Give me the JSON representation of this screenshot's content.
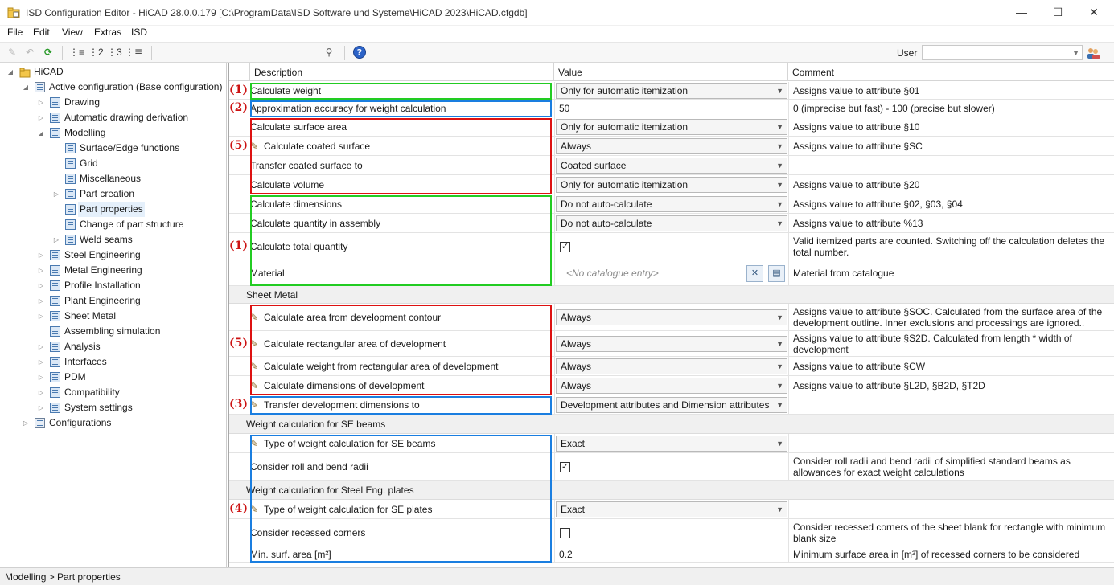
{
  "window": {
    "title": "ISD Configuration Editor  -  HiCAD 28.0.0.179 [C:\\ProgramData\\ISD Software und Systeme\\HiCAD 2023\\HiCAD.cfgdb]",
    "minimize": "—",
    "maximize": "☐",
    "close": "✕"
  },
  "menu": [
    "File",
    "Edit",
    "View",
    "Extras",
    "ISD"
  ],
  "toolbar": {
    "user_label": "User",
    "user_value": ""
  },
  "tree": [
    {
      "label": "HiCAD",
      "level": 0,
      "exp": "◢",
      "icon": "folder"
    },
    {
      "label": "Active configuration (Base configuration)",
      "level": 1,
      "exp": "◢",
      "icon": "config"
    },
    {
      "label": "Drawing",
      "level": 2,
      "exp": "▷"
    },
    {
      "label": "Automatic drawing derivation",
      "level": 2,
      "exp": "▷"
    },
    {
      "label": "Modelling",
      "level": 2,
      "exp": "◢"
    },
    {
      "label": "Surface/Edge functions",
      "level": 3,
      "exp": ""
    },
    {
      "label": "Grid",
      "level": 3,
      "exp": ""
    },
    {
      "label": "Miscellaneous",
      "level": 3,
      "exp": ""
    },
    {
      "label": "Part creation",
      "level": 3,
      "exp": "▷"
    },
    {
      "label": "Part properties",
      "level": 3,
      "exp": "",
      "selected": true
    },
    {
      "label": "Change of part structure",
      "level": 3,
      "exp": ""
    },
    {
      "label": "Weld seams",
      "level": 3,
      "exp": "▷"
    },
    {
      "label": "Steel Engineering",
      "level": 2,
      "exp": "▷"
    },
    {
      "label": "Metal Engineering",
      "level": 2,
      "exp": "▷"
    },
    {
      "label": "Profile Installation",
      "level": 2,
      "exp": "▷"
    },
    {
      "label": "Plant Engineering",
      "level": 2,
      "exp": "▷"
    },
    {
      "label": "Sheet Metal",
      "level": 2,
      "exp": "▷"
    },
    {
      "label": "Assembling simulation",
      "level": 2,
      "exp": ""
    },
    {
      "label": "Analysis",
      "level": 2,
      "exp": "▷"
    },
    {
      "label": "Interfaces",
      "level": 2,
      "exp": "▷"
    },
    {
      "label": "PDM",
      "level": 2,
      "exp": "▷"
    },
    {
      "label": "Compatibility",
      "level": 2,
      "exp": "▷"
    },
    {
      "label": "System settings",
      "level": 2,
      "exp": "▷"
    },
    {
      "label": "Configurations",
      "level": 1,
      "exp": "▷",
      "icon": "config"
    }
  ],
  "grid": {
    "headers": {
      "desc": "Description",
      "value": "Value",
      "comment": "Comment"
    },
    "rows": [
      {
        "type": "row",
        "desc": "Calculate weight",
        "vtype": "combo",
        "value": "Only for automatic itemization",
        "comment": "Assigns value to attribute §01"
      },
      {
        "type": "row",
        "desc": "Approximation accuracy for weight calculation",
        "vtype": "text",
        "value": "50",
        "comment": "0 (imprecise but fast) - 100 (precise but slower)"
      },
      {
        "type": "row",
        "desc": "Calculate surface area",
        "vtype": "combo",
        "value": "Only for automatic itemization",
        "comment": "Assigns value to attribute §10"
      },
      {
        "type": "row",
        "desc": "Calculate coated surface",
        "pencil": true,
        "vtype": "combo",
        "value": "Always",
        "comment": "Assigns value to attribute §SC"
      },
      {
        "type": "row",
        "desc": "Transfer coated surface to",
        "vtype": "combo",
        "value": "Coated surface",
        "comment": ""
      },
      {
        "type": "row",
        "desc": "Calculate volume",
        "vtype": "combo",
        "value": "Only for automatic itemization",
        "comment": "Assigns value to attribute §20"
      },
      {
        "type": "row",
        "desc": "Calculate dimensions",
        "vtype": "combo",
        "value": "Do not auto-calculate",
        "comment": "Assigns value to attribute §02, §03, §04"
      },
      {
        "type": "row",
        "desc": "Calculate quantity in assembly",
        "vtype": "combo",
        "value": "Do not auto-calculate",
        "comment": "Assigns value to attribute %13"
      },
      {
        "type": "row",
        "desc": "Calculate total quantity",
        "vtype": "check",
        "checked": true,
        "comment": "Valid itemized parts are counted. Switching off the calculation deletes the total number."
      },
      {
        "type": "row",
        "desc": "Material",
        "vtype": "catalogue",
        "value": "<No catalogue entry>",
        "comment": "Material from catalogue"
      },
      {
        "type": "section",
        "title": "Sheet Metal"
      },
      {
        "type": "row",
        "desc": "Calculate area from development contour",
        "pencil": true,
        "vtype": "combo",
        "value": "Always",
        "comment": "Assigns value to attribute §SOC. Calculated from the surface area of the development outline. Inner exclusions and processings are ignored.."
      },
      {
        "type": "row",
        "desc": "Calculate rectangular area of development",
        "pencil": true,
        "vtype": "combo",
        "value": "Always",
        "comment": "Assigns value to attribute §S2D. Calculated from length * width of development"
      },
      {
        "type": "row",
        "desc": "Calculate weight from rectangular area of development",
        "pencil": true,
        "vtype": "combo",
        "value": "Always",
        "comment": "Assigns value to attribute §CW"
      },
      {
        "type": "row",
        "desc": "Calculate dimensions of development",
        "pencil": true,
        "vtype": "combo",
        "value": "Always",
        "comment": "Assigns value to attribute §L2D, §B2D, §T2D"
      },
      {
        "type": "row",
        "desc": "Transfer development dimensions to",
        "pencil": true,
        "vtype": "combo",
        "value": "Development attributes and Dimension attributes",
        "comment": ""
      },
      {
        "type": "section",
        "title": "Weight calculation for SE beams"
      },
      {
        "type": "row",
        "desc": "Type of weight calculation for SE beams",
        "pencil": true,
        "vtype": "combo",
        "value": "Exact",
        "comment": ""
      },
      {
        "type": "row",
        "desc": "Consider roll and bend radii",
        "vtype": "check",
        "checked": true,
        "comment": "Consider roll radii and bend radii of simplified standard beams as allowances for exact weight calculations"
      },
      {
        "type": "section",
        "title": "Weight calculation for Steel Eng. plates"
      },
      {
        "type": "row",
        "desc": "Type of weight calculation for SE plates",
        "pencil": true,
        "vtype": "combo",
        "value": "Exact",
        "comment": ""
      },
      {
        "type": "row",
        "desc": "Consider recessed corners",
        "vtype": "check",
        "checked": false,
        "comment": "Consider recessed corners of the sheet blank for rectangle with minimum blank size"
      },
      {
        "type": "row",
        "desc": "Min. surf. area [m²]",
        "vtype": "text",
        "value": "0.2",
        "comment": "Minimum surface area in [m²] of recessed corners to be considered"
      }
    ]
  },
  "markers": [
    "(1)",
    "(2)",
    "(5)",
    "(1)",
    "(5)",
    "(3)",
    "(4)"
  ],
  "highlight_colors": {
    "green": "#22cc22",
    "red": "#dd1111",
    "blue": "#1a7ee0"
  },
  "statusbar": {
    "path": "Modelling > Part properties"
  }
}
